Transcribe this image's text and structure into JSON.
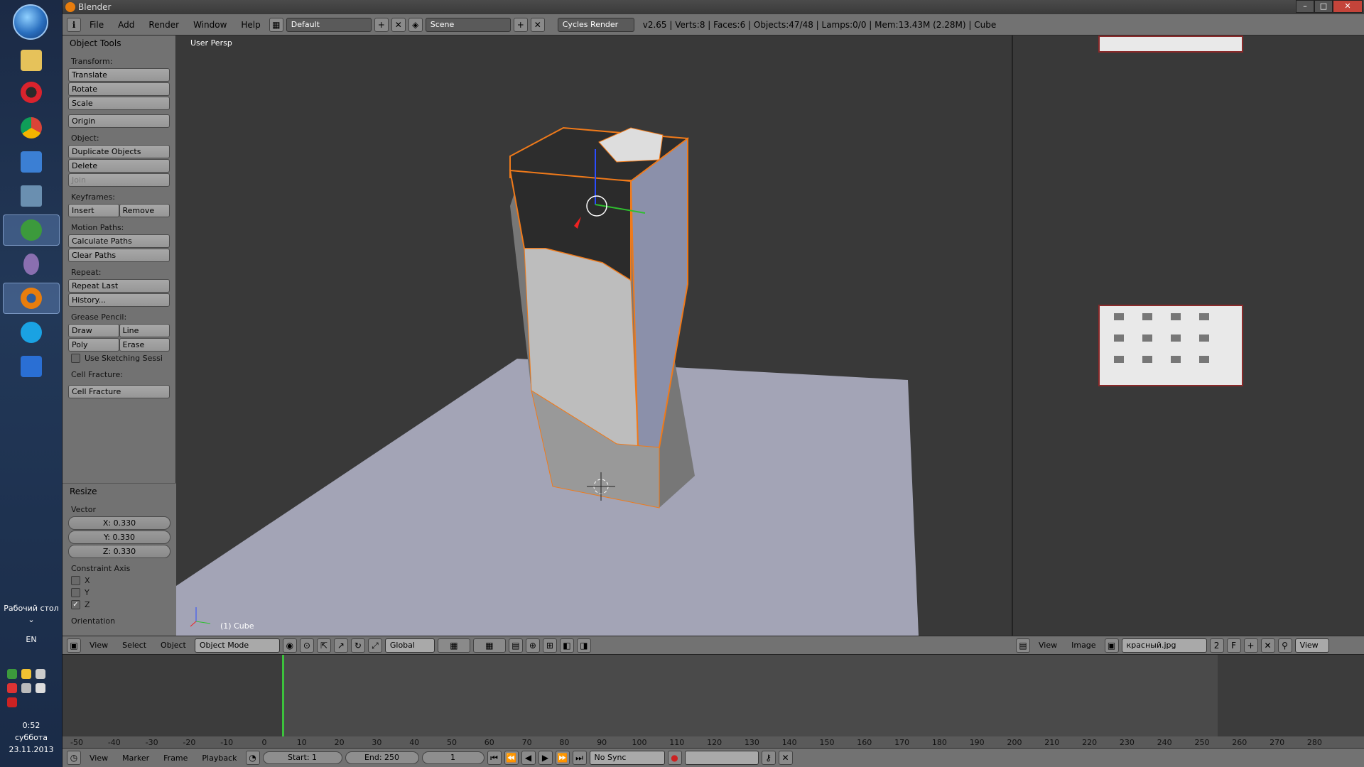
{
  "window": {
    "title": "Blender",
    "min": "–",
    "max": "□",
    "close": "✕"
  },
  "taskbar": {
    "desktop_label": "Рабочий стол",
    "lang": "EN",
    "time": "0:52",
    "day": "суббота",
    "date": "23.11.2013",
    "apps": [
      "explorer-icon",
      "opera-icon",
      "chrome-icon",
      "media-player-icon",
      "computer-icon",
      "utorrent-icon",
      "tor-icon",
      "blender-icon",
      "skype-icon",
      "vs-icon"
    ]
  },
  "infobar": {
    "menus": [
      "File",
      "Add",
      "Render",
      "Window",
      "Help"
    ],
    "layout": "Default",
    "scene": "Scene",
    "engine": "Cycles Render",
    "stats": "v2.65 | Verts:8 | Faces:6 | Objects:47/48 | Lamps:0/0 | Mem:13.43M (2.28M) | Cube"
  },
  "toolshelf": {
    "title": "Object Tools",
    "transform_label": "Transform:",
    "translate": "Translate",
    "rotate": "Rotate",
    "scale": "Scale",
    "origin": "Origin",
    "object_label": "Object:",
    "duplicate": "Duplicate Objects",
    "delete": "Delete",
    "join": "Join",
    "keyframes_label": "Keyframes:",
    "insert": "Insert",
    "remove": "Remove",
    "motion_label": "Motion Paths:",
    "calc_paths": "Calculate Paths",
    "clear_paths": "Clear Paths",
    "repeat_label": "Repeat:",
    "repeat_last": "Repeat Last",
    "history": "History...",
    "grease_label": "Grease Pencil:",
    "draw": "Draw",
    "line": "Line",
    "poly": "Poly",
    "erase": "Erase",
    "sketching": "Use Sketching Sessi",
    "cell_label": "Cell Fracture:",
    "cell_fracture": "Cell Fracture"
  },
  "redo": {
    "title": "Resize",
    "vector_label": "Vector",
    "x": "X: 0.330",
    "y": "Y: 0.330",
    "z": "Z: 0.330",
    "constraint_label": "Constraint Axis",
    "cx": "X",
    "cy": "Y",
    "cz": "Z",
    "orientation_label": "Orientation"
  },
  "viewport": {
    "title": "User Persp",
    "object": "(1) Cube",
    "header": {
      "menus": [
        "View",
        "Select",
        "Object"
      ],
      "mode": "Object Mode",
      "orientation": "Global"
    }
  },
  "image_editor": {
    "header": {
      "menus": [
        "View",
        "Image"
      ],
      "image_name": "красный.jpg",
      "users": "2",
      "fake": "F",
      "view": "View"
    }
  },
  "timeline": {
    "ticks": [
      "-50",
      "-40",
      "-30",
      "-20",
      "-10",
      "0",
      "10",
      "20",
      "30",
      "40",
      "50",
      "60",
      "70",
      "80",
      "90",
      "100",
      "110",
      "120",
      "130",
      "140",
      "150",
      "160",
      "170",
      "180",
      "190",
      "200",
      "210",
      "220",
      "230",
      "240",
      "250",
      "260",
      "270",
      "280"
    ],
    "header": {
      "menus": [
        "View",
        "Marker",
        "Frame",
        "Playback"
      ],
      "start": "Start: 1",
      "end": "End: 250",
      "current": "1",
      "sync": "No Sync"
    }
  }
}
